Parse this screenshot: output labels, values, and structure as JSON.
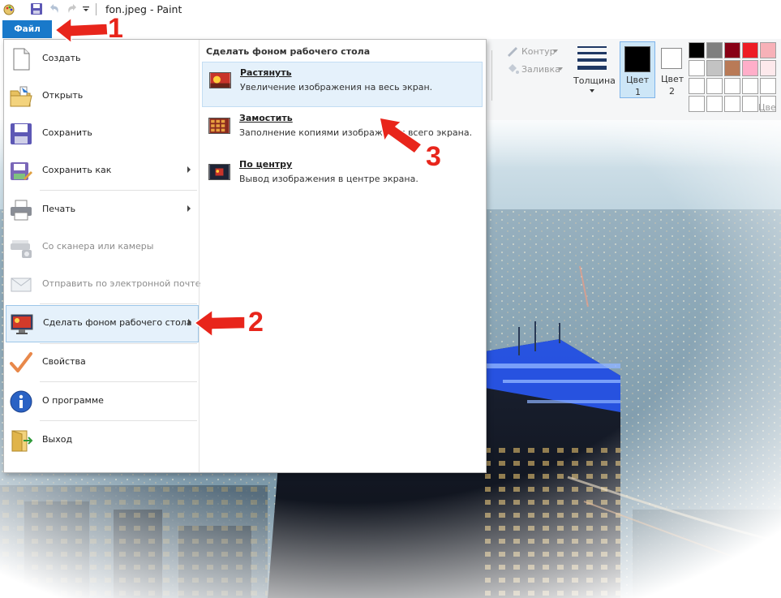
{
  "window": {
    "title": "fon.jpeg - Paint"
  },
  "ribbon": {
    "file_tab": "Файл",
    "outline_label": "Контур",
    "fill_label": "Заливка",
    "thickness_label": "Толщина",
    "color1_line1": "Цвет",
    "color1_line2": "1",
    "color2_line1": "Цвет",
    "color2_line2": "2",
    "colors_group_partial": "Цве",
    "palette_row1": [
      "#000000",
      "#7f7f7f",
      "#880015",
      "#ed1c24",
      "#f7b1b8"
    ],
    "palette_row2": [
      "#ffffff",
      "#c3c3c3",
      "#b97a57",
      "#ffaec9",
      "#fde9ec"
    ],
    "color1": "#000000",
    "color2": "#ffffff"
  },
  "file_menu": {
    "items": [
      {
        "label": "Создать",
        "icon": "new-document-icon",
        "submenu": false,
        "enabled": true
      },
      {
        "label": "Открыть",
        "icon": "open-folder-icon",
        "submenu": false,
        "enabled": true
      },
      {
        "label": "Сохранить",
        "icon": "save-floppy-icon",
        "submenu": false,
        "enabled": true
      },
      {
        "label": "Сохранить как",
        "icon": "save-as-icon",
        "submenu": true,
        "enabled": true
      },
      {
        "label": "Печать",
        "icon": "printer-icon",
        "submenu": true,
        "enabled": true
      },
      {
        "label": "Со сканера или камеры",
        "icon": "scanner-icon",
        "submenu": false,
        "enabled": false
      },
      {
        "label": "Отправить по электронной почте",
        "icon": "email-icon",
        "submenu": false,
        "enabled": false
      },
      {
        "label": "Сделать фоном рабочего стола",
        "icon": "desktop-background-icon",
        "submenu": true,
        "enabled": true,
        "active": true
      },
      {
        "label": "Свойства",
        "icon": "checkmark-icon",
        "submenu": false,
        "enabled": true
      },
      {
        "label": "О программе",
        "icon": "info-icon",
        "submenu": false,
        "enabled": true
      },
      {
        "label": "Выход",
        "icon": "exit-icon",
        "submenu": false,
        "enabled": true
      }
    ],
    "submenu": {
      "header": "Сделать фоном рабочего стола",
      "options": [
        {
          "title": "Растянуть",
          "desc": "Увеличение изображения на весь экран.",
          "icon": "stretch-icon"
        },
        {
          "title": "Замостить",
          "desc": "Заполнение копиями изображения всего экрана.",
          "icon": "tile-icon"
        },
        {
          "title": "По центру",
          "desc": "Вывод изображения в центре экрана.",
          "icon": "center-icon"
        }
      ]
    }
  },
  "annotations": [
    "1",
    "2",
    "3"
  ],
  "accent": "#1979ca",
  "arrow_color": "#e8251b"
}
